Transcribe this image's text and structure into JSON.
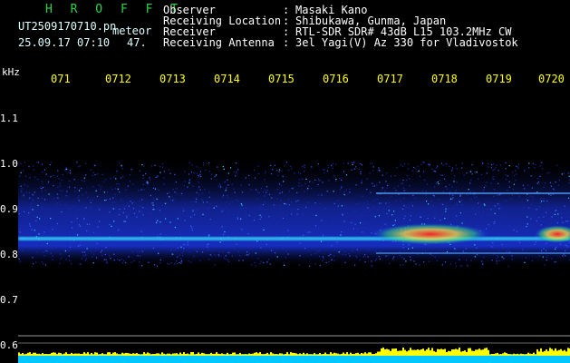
{
  "header": {
    "brand": "H R O F F T",
    "filename": "UT2509170710.pn",
    "meteor_label": "meteor",
    "datetime": "25.09.17 07:10",
    "count": "47.",
    "fields": [
      {
        "label": "Observer",
        "sep": ":",
        "value": "Masaki Kano"
      },
      {
        "label": "Receiving Location",
        "sep": ":",
        "value": "Shibukawa, Gunma, Japan"
      },
      {
        "label": "Receiver",
        "sep": ":",
        "value": "RTL-SDR SDR# 43dB L15 103.2MHz CW"
      },
      {
        "label": "Receiving Antenna",
        "sep": ":",
        "value": "3el Yagi(V) Az 330 for Vladivostok"
      }
    ]
  },
  "axis": {
    "unit": "kHz",
    "y_ticks": [
      "1.1",
      "1.0",
      "0.9",
      "0.8",
      "0.7",
      "0.6"
    ]
  },
  "time_labels": [
    "071",
    "0712",
    "0713",
    "0714",
    "0715",
    "0716",
    "0717",
    "0718",
    "0719",
    "0720"
  ],
  "colors": {
    "background": "#000000",
    "brand": "#2fd34a",
    "time": "#ffff00",
    "noise_band": "#1e3cff",
    "signal_line": "#30e0ff",
    "hot": "#ff3030",
    "bottom_bar": "#00c8ff",
    "bottom_bar_top": "#ffff00"
  }
}
